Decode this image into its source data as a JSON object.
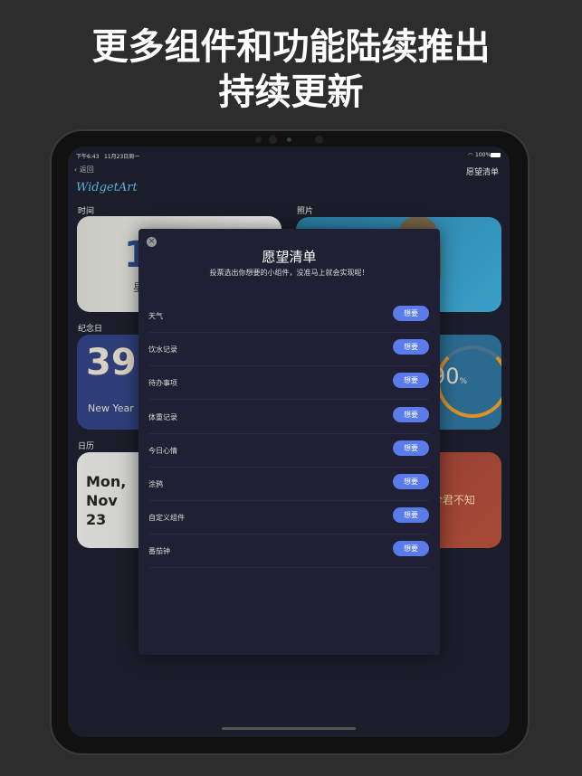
{
  "headline": {
    "line1": "更多组件和功能陆续推出",
    "line2": "持续更新"
  },
  "status": {
    "time": "下午6:43",
    "date": "11月23日周一",
    "battery": "100%"
  },
  "nav": {
    "back": "返回",
    "title": "愿望清单"
  },
  "logo": "WidgetArt",
  "sections": {
    "time": "时间",
    "photo": "照片",
    "anniversary": "纪念日",
    "calendar": "日历"
  },
  "widgets": {
    "time_digit": "1",
    "time_sub": "星",
    "anniv_number": "39",
    "anniv_label": "New Year",
    "progress_value": "90",
    "progress_unit": "%",
    "progress_fraction": 0.9,
    "calendar_line1": "Mon,",
    "calendar_line2": "Nov",
    "calendar_line3": "23",
    "poem": "兮君不知"
  },
  "modal": {
    "title": "愿望清单",
    "subtitle": "投票选出你想要的小组件，没准马上就会实现呢！",
    "button_label": "想要",
    "items": [
      "天气",
      "饮水记录",
      "待办事项",
      "体重记录",
      "今日心情",
      "涂鸦",
      "自定义组件",
      "番茄钟"
    ]
  },
  "colors": {
    "accent": "#5b7bea",
    "background": "#1b1d2a",
    "modal": "#1f2033"
  }
}
